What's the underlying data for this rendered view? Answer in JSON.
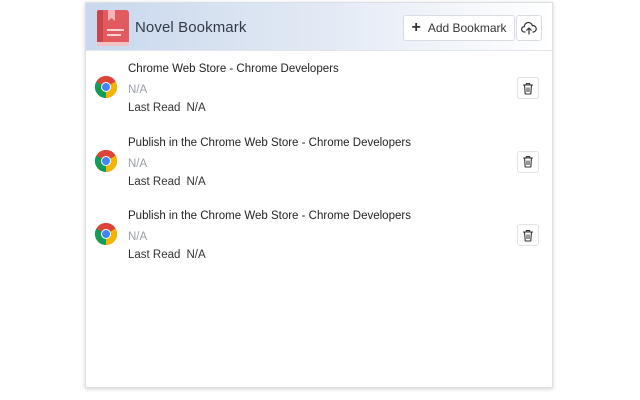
{
  "header": {
    "title": "Novel Bookmark",
    "add_label": "Add Bookmark",
    "logo_icon": "book-icon",
    "upload_icon": "cloud-upload-icon"
  },
  "colors": {
    "header_gradient_start": "#c9d8ee",
    "logo_red": "#e05a5f"
  },
  "bookmarks": [
    {
      "title": "Chrome Web Store - Chrome Developers",
      "subtitle": "N/A",
      "last_read_label": "Last Read",
      "last_read_value": "N/A",
      "favicon": "chrome-icon",
      "delete_icon": "trash-icon"
    },
    {
      "title": "Publish in the Chrome Web Store - Chrome Developers",
      "subtitle": "N/A",
      "last_read_label": "Last Read",
      "last_read_value": "N/A",
      "favicon": "chrome-icon",
      "delete_icon": "trash-icon"
    },
    {
      "title": "Publish in the Chrome Web Store - Chrome Developers",
      "subtitle": "N/A",
      "last_read_label": "Last Read",
      "last_read_value": "N/A",
      "favicon": "chrome-icon",
      "delete_icon": "trash-icon"
    }
  ]
}
